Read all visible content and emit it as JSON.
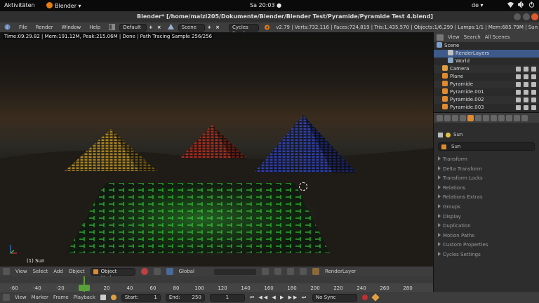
{
  "gnome_bar": {
    "activities": "Aktivitäten",
    "app_name": "Blender ▾",
    "clock": "Sa 20:03 ●",
    "language": "de ▾"
  },
  "window": {
    "title": "Blender* [/home/malzi205/Dokumente/Blender/Blender Test/Pyramide/Pyramide Test 4.blend]"
  },
  "info_header": {
    "menus": [
      "File",
      "Render",
      "Window",
      "Help"
    ],
    "layout": "Default",
    "scene": "Scene",
    "engine": "Cycles Render",
    "stats": "v2.79 | Verts:732,116 | Faces:724,819 | Tris:1,435,570 | Objects:1/6,299 | Lamps:1/1 | Mem:685.79M | Sun"
  },
  "viewport": {
    "render_stats": "Time:09:29.82 | Mem:191.12M, Peak:215.06M | Done | Path Tracing Sample 256/256",
    "active_object_label": "(1) Sun"
  },
  "view_header": {
    "menus": [
      "View",
      "Select",
      "Add",
      "Object"
    ],
    "mode": "Object Mode",
    "orientation": "Global",
    "render_layer": "RenderLayer"
  },
  "timeline_ruler": {
    "labels": [
      "-60",
      "-40",
      "-20",
      "0",
      "20",
      "40",
      "60",
      "80",
      "100",
      "120",
      "140",
      "160",
      "180",
      "200",
      "220",
      "240",
      "260",
      "280"
    ]
  },
  "timeline_header": {
    "menus": [
      "View",
      "Marker",
      "Frame",
      "Playback"
    ],
    "start_label": "Start:",
    "start_value": "1",
    "end_label": "End:",
    "end_value": "250",
    "current_frame": "1",
    "sync": "No Sync"
  },
  "outliner": {
    "header": [
      "View",
      "Search",
      "All Scenes"
    ],
    "rows": [
      {
        "label": "Scene",
        "icon": "scene-icon",
        "color": "#7aa0d0"
      },
      {
        "label": "RenderLayers",
        "icon": "renderlayer-icon",
        "color": "#c0c0c0"
      },
      {
        "label": "World",
        "icon": "world-icon",
        "color": "#8aa8c8"
      },
      {
        "label": "Camera",
        "icon": "camera-icon",
        "color": "#e0a040"
      },
      {
        "label": "Plane",
        "icon": "mesh-icon",
        "color": "#e08a30"
      },
      {
        "label": "Pyramide",
        "icon": "mesh-icon",
        "color": "#e08a30"
      },
      {
        "label": "Pyramide.001",
        "icon": "mesh-icon",
        "color": "#e08a30"
      },
      {
        "label": "Pyramide.002",
        "icon": "mesh-icon",
        "color": "#e08a30"
      },
      {
        "label": "Pyramide.003",
        "icon": "mesh-icon",
        "color": "#e08a30"
      }
    ]
  },
  "properties": {
    "context": "Sun",
    "object_name": "Sun",
    "panels": [
      "Transform",
      "Delta Transform",
      "Transform Locks",
      "Relations",
      "Relations Extras",
      "Groups",
      "Display",
      "Duplication",
      "Motion Paths",
      "Custom Properties",
      "Cycles Settings"
    ]
  },
  "colors": {
    "accent_orange": "#e87d0d",
    "frame_cursor": "#5aa03a",
    "selection_blue": "#3d5a8a"
  }
}
